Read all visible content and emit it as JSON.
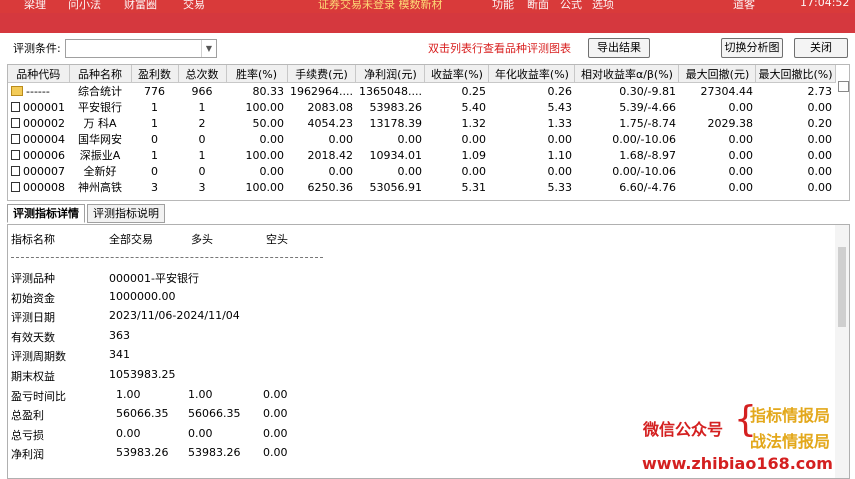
{
  "menubar": {
    "items": [
      "梁理",
      "问小法",
      "财富圈",
      "交易",
      "证券交易未登录 模数新材",
      "功能",
      "断面",
      "公式",
      "选项",
      "道客",
      "17:04:52"
    ],
    "highlight_index": 4
  },
  "toolbar": {
    "filter_label": "评测条件:",
    "filter_value": "",
    "hint": "双击列表行查看品种评测图表",
    "export_button": "导出结果",
    "switch_button": "切换分析图",
    "close_button": "关闭"
  },
  "grid": {
    "columns": [
      "品种代码",
      "品种名称",
      "盈利数",
      "总次数",
      "胜率(%)",
      "手续费(元)",
      "净利润(元)",
      "收益率(%)",
      "年化收益率(%)",
      "相对收益率α/β(%)",
      "最大回撤(元)",
      "最大回撤比(%)"
    ],
    "rows": [
      {
        "icon": "folder",
        "cells": [
          "------",
          "综合统计",
          "776",
          "966",
          "80.33",
          "1962964....",
          "1365048....",
          "0.25",
          "0.26",
          "0.30/-9.81",
          "27304.44",
          "2.73"
        ]
      },
      {
        "icon": "doc",
        "cells": [
          "000001",
          "平安银行",
          "1",
          "1",
          "100.00",
          "2083.08",
          "53983.26",
          "5.40",
          "5.43",
          "5.39/-4.66",
          "0.00",
          "0.00"
        ]
      },
      {
        "icon": "doc",
        "cells": [
          "000002",
          "万 科A",
          "1",
          "2",
          "50.00",
          "4054.23",
          "13178.39",
          "1.32",
          "1.33",
          "1.75/-8.74",
          "2029.38",
          "0.20"
        ]
      },
      {
        "icon": "doc",
        "cells": [
          "000004",
          "国华网安",
          "0",
          "0",
          "0.00",
          "0.00",
          "0.00",
          "0.00",
          "0.00",
          "0.00/-10.06",
          "0.00",
          "0.00"
        ]
      },
      {
        "icon": "doc",
        "cells": [
          "000006",
          "深振业A",
          "1",
          "1",
          "100.00",
          "2018.42",
          "10934.01",
          "1.09",
          "1.10",
          "1.68/-8.97",
          "0.00",
          "0.00"
        ]
      },
      {
        "icon": "doc",
        "cells": [
          "000007",
          "全新好",
          "0",
          "0",
          "0.00",
          "0.00",
          "0.00",
          "0.00",
          "0.00",
          "0.00/-10.06",
          "0.00",
          "0.00"
        ]
      },
      {
        "icon": "doc",
        "cells": [
          "000008",
          "神州高铁",
          "3",
          "3",
          "100.00",
          "6250.36",
          "53056.91",
          "5.31",
          "5.33",
          "6.60/-4.76",
          "0.00",
          "0.00"
        ]
      }
    ]
  },
  "tabs": [
    "评测指标详情",
    "评测指标说明"
  ],
  "detail": {
    "headers": [
      "指标名称",
      "全部交易",
      "多头",
      "空头"
    ],
    "rows": [
      {
        "label": "评测品种",
        "values": [
          "000001-平安银行"
        ]
      },
      {
        "label": "初始资金",
        "values": [
          "1000000.00"
        ]
      },
      {
        "label": "评测日期",
        "values": [
          "2023/11/06-2024/11/04"
        ]
      },
      {
        "label": "有效天数",
        "values": [
          "363"
        ]
      },
      {
        "label": "评测周期数",
        "values": [
          "341"
        ]
      },
      {
        "label": "期末权益",
        "values": [
          "1053983.25"
        ]
      },
      {
        "label": "盈亏时间比",
        "values": [
          "1.00",
          "1.00",
          "0.00"
        ]
      },
      {
        "label": "总盈利",
        "values": [
          "56066.35",
          "56066.35",
          "0.00"
        ]
      },
      {
        "label": "总亏损",
        "values": [
          "0.00",
          "0.00",
          "0.00"
        ]
      },
      {
        "label": "净利润",
        "values": [
          "53983.26",
          "53983.26",
          "0.00"
        ]
      }
    ]
  },
  "watermark": {
    "line1": "微信公众号",
    "line2": "指标情报局",
    "line3": "战法情报局",
    "line4": "www.zhibiao168.com"
  }
}
